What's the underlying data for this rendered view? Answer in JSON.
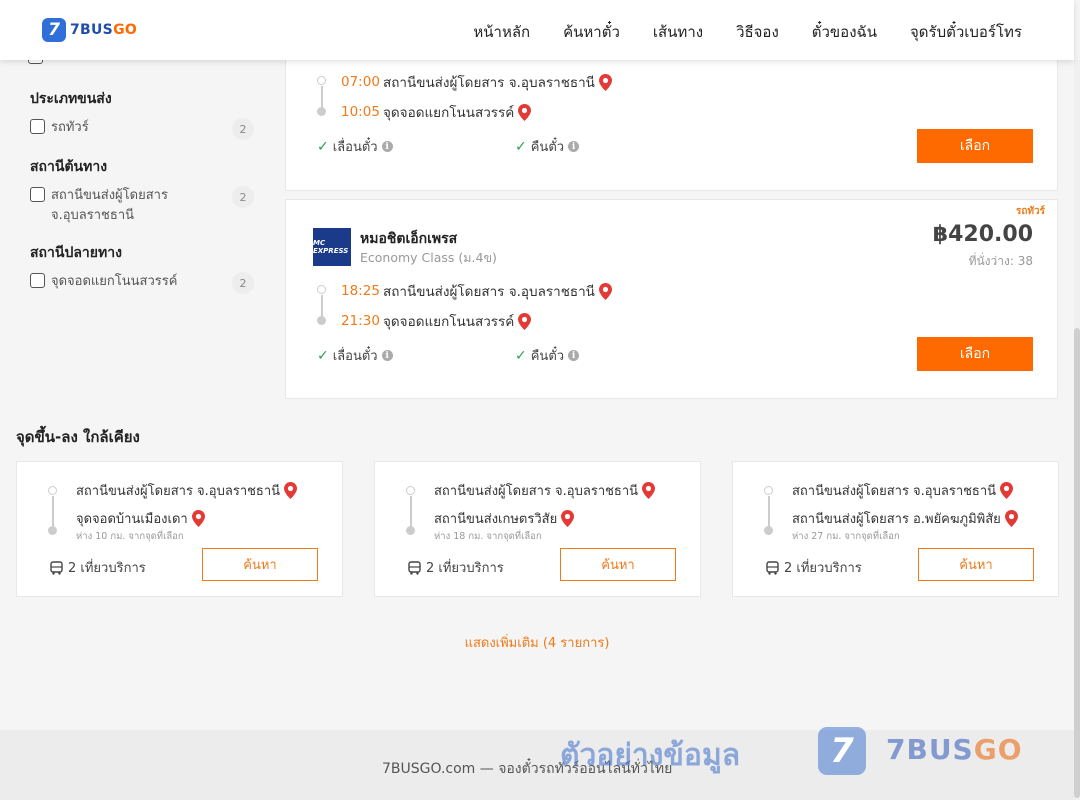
{
  "brand": {
    "badge": "7",
    "name_main": "7BUS",
    "name_accent": "GO"
  },
  "nav": [
    "หน้าหลัก",
    "ค้นหาตั๋ว",
    "เส้นทาง",
    "วิธีจอง",
    "ตั๋วของฉัน",
    "จุดรับตั๋วเบอร์โทร"
  ],
  "filters": {
    "vehicle_title": "ประเภทขนส่ง",
    "vehicle": {
      "label": "รถทัวร์",
      "count": "2"
    },
    "origin_title": "สถานีต้นทาง",
    "origin": {
      "label_1": "สถานีขนส่งผู้โดยสาร",
      "label_2": "จ.อุบลราชธานี",
      "count": "2"
    },
    "dest_title": "สถานีปลายทาง",
    "dest": {
      "label": "จุดจอดแยกโนนสวรรค์",
      "count": "2"
    }
  },
  "trips": [
    {
      "depart_time": "07:00",
      "depart_stop": "สถานีขนส่งผู้โดยสาร จ.อุบลราชธานี",
      "arrive_time": "10:05",
      "arrive_stop": "จุดจอดแยกโนนสวรรค์",
      "feature_1": "เลื่อนตั๋ว",
      "feature_2": "คืนตั๋ว",
      "select_label": "เลือก"
    },
    {
      "tag": "รถทัวร์",
      "operator_logo": "MC EXPRESS",
      "operator": "หมอชิตเอ็กเพรส",
      "class": "Economy Class (ม.4ข)",
      "price": "฿420.00",
      "seats": "ที่นั่งว่าง: 38",
      "depart_time": "18:25",
      "depart_stop": "สถานีขนส่งผู้โดยสาร จ.อุบลราชธานี",
      "arrive_time": "21:30",
      "arrive_stop": "จุดจอดแยกโนนสวรรค์",
      "feature_1": "เลื่อนตั๋ว",
      "feature_2": "คืนตั๋ว",
      "select_label": "เลือก"
    }
  ],
  "nearby": {
    "title": "จุดขึ้น-ลง ใกล้เคียง",
    "items": [
      {
        "from": "สถานีขนส่งผู้โดยสาร จ.อุบลราชธานี",
        "to": "จุดจอดบ้านเมืองเดา",
        "distance": "ห่าง 10 กม. จากจุดที่เลือก",
        "trips": "2 เที่ยวบริการ",
        "search_label": "ค้นหา"
      },
      {
        "from": "สถานีขนส่งผู้โดยสาร จ.อุบลราชธานี",
        "to": "สถานีขนส่งเกษตรวิสัย",
        "distance": "ห่าง 18 กม. จากจุดที่เลือก",
        "trips": "2 เที่ยวบริการ",
        "search_label": "ค้นหา"
      },
      {
        "from": "สถานีขนส่งผู้โดยสาร จ.อุบลราชธานี",
        "to": "สถานีขนส่งผู้โดยสาร อ.พยัคฆภูมิพิสัย",
        "distance": "ห่าง 27 กม. จากจุดที่เลือก",
        "trips": "2 เที่ยวบริการ",
        "search_label": "ค้นหา"
      }
    ],
    "show_more": "แสดงเพิ่มเติม (4 รายการ)"
  },
  "footer": {
    "text": "7BUSGO.com — จองตั๋วรถทัวร์ออนไลน์ทั่วไทย"
  },
  "watermark": {
    "text": "ตัวอย่างข้อมูล",
    "badge": "7",
    "brand_main": "7BUS",
    "brand_accent": "GO"
  },
  "colors": {
    "accent": "#ff6a00",
    "brand": "#2f6fd8",
    "check": "#2aa14a"
  }
}
